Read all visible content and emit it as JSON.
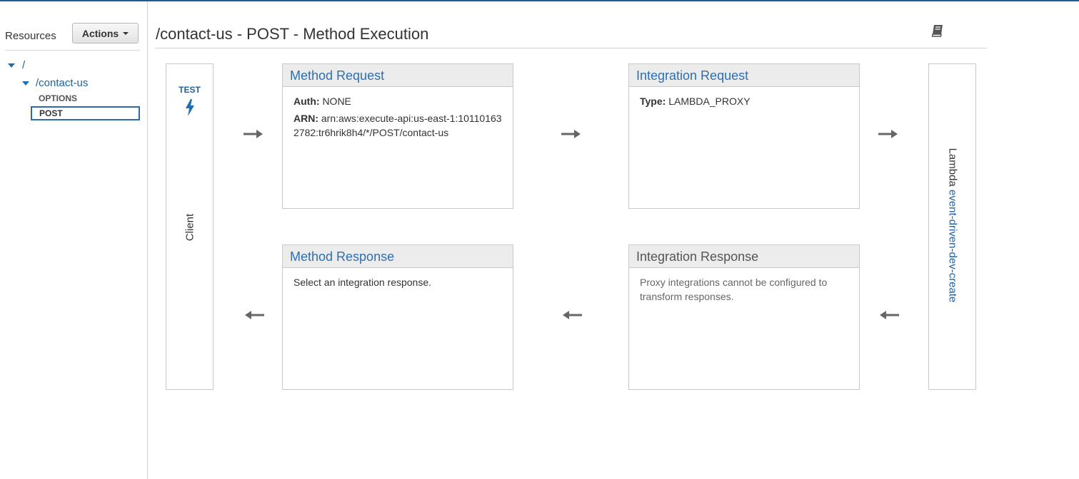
{
  "sidebar": {
    "title": "Resources",
    "actions_label": "Actions",
    "tree": {
      "root": "/",
      "child": "/contact-us",
      "methods": [
        "OPTIONS",
        "POST"
      ],
      "selected_method": "POST"
    }
  },
  "page": {
    "title": "/contact-us - POST - Method Execution"
  },
  "client": {
    "test_label": "TEST",
    "label": "Client"
  },
  "method_request": {
    "title": "Method Request",
    "auth_key": "Auth:",
    "auth_value": "NONE",
    "arn_key": "ARN:",
    "arn_value": "arn:aws:execute-api:us-east-1:101101632782:tr6hrik8h4/*/POST/contact-us"
  },
  "integration_request": {
    "title": "Integration Request",
    "type_key": "Type:",
    "type_value": "LAMBDA_PROXY"
  },
  "method_response": {
    "title": "Method Response",
    "text": "Select an integration response."
  },
  "integration_response": {
    "title": "Integration Response",
    "text": "Proxy integrations cannot be configured to transform responses."
  },
  "lambda": {
    "label": "Lambda",
    "function_name": "event-driven-dev-create"
  },
  "colors": {
    "link": "#1f5f9f",
    "top_border": "#1f5a96",
    "header_bg": "#ececec"
  },
  "icons": [
    "book-icon",
    "lightning-bolt-icon",
    "arrow-right-icon",
    "arrow-left-icon",
    "caret-down-icon"
  ]
}
